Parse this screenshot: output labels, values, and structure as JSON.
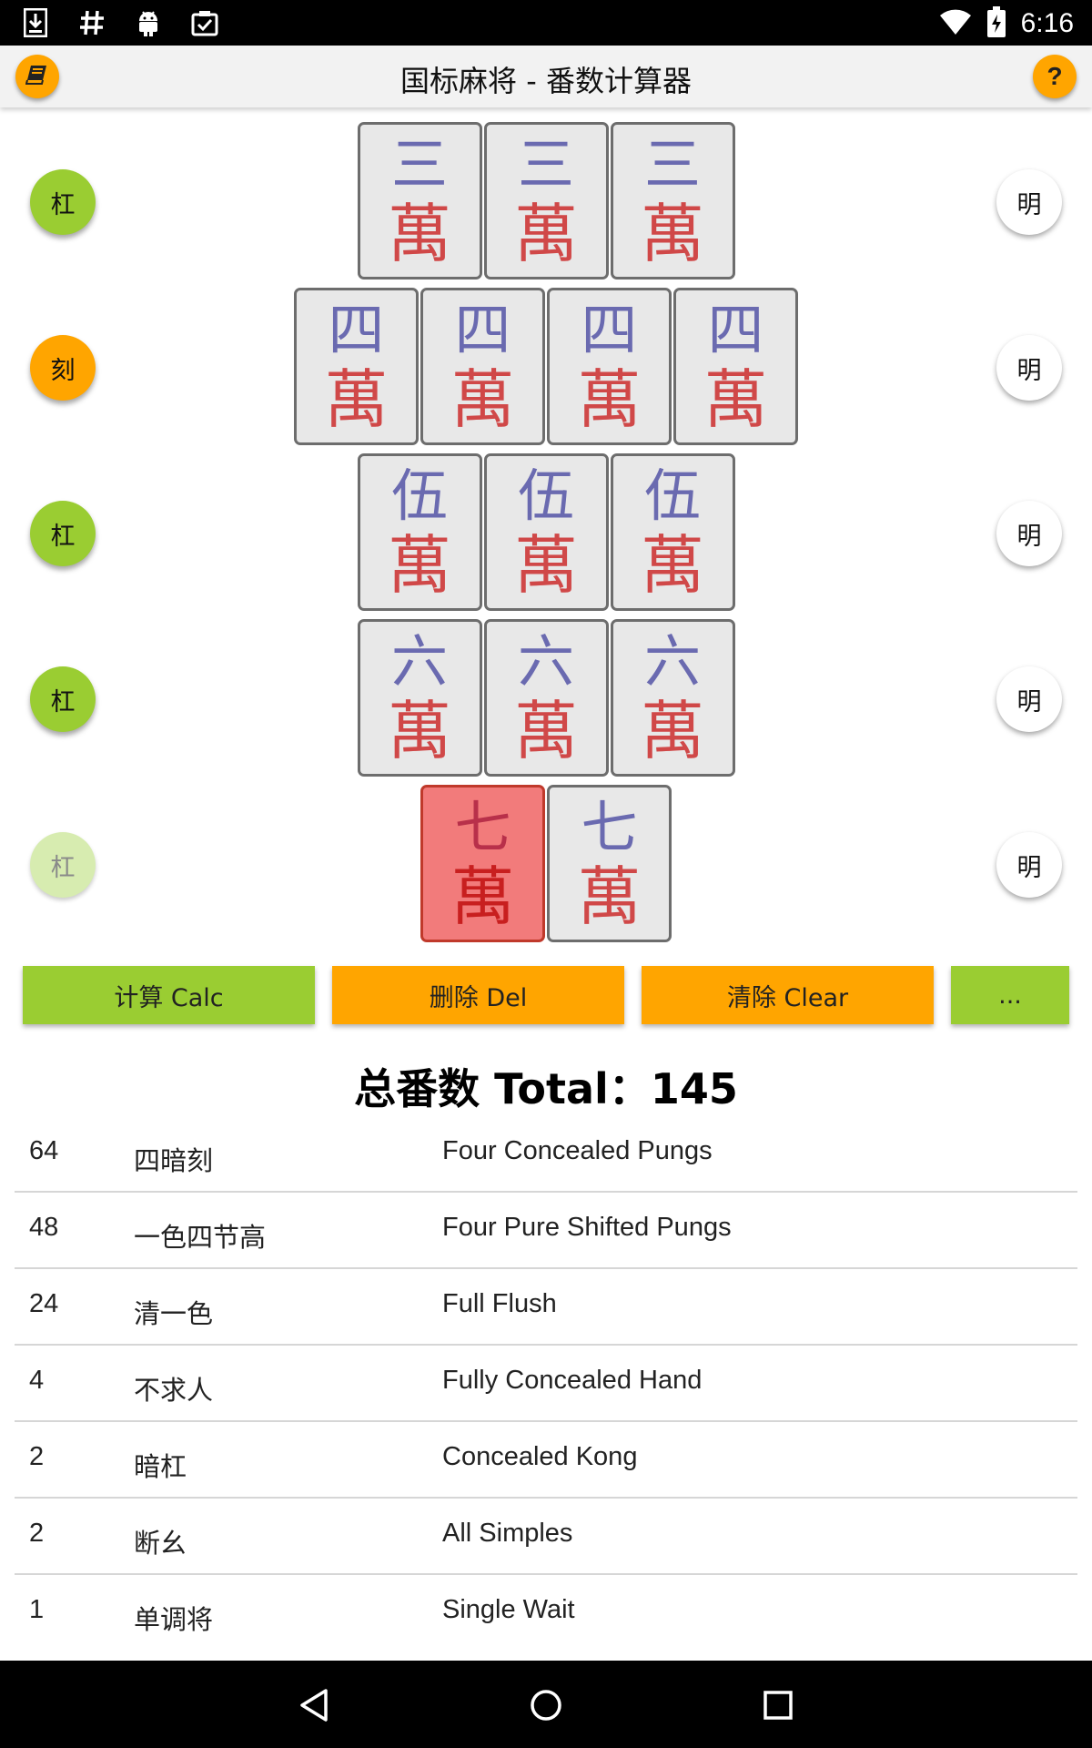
{
  "status_bar": {
    "time": "6:16",
    "left_icons": [
      "download-icon",
      "hash-icon",
      "android-icon",
      "clipboard-check-icon"
    ],
    "right_icons": [
      "wifi-icon",
      "battery-icon"
    ]
  },
  "app_bar": {
    "title": "国标麻将 - 番数计算器",
    "left_icon": "book-icon",
    "help_label": "?"
  },
  "rows": [
    {
      "type_label": "杠",
      "type_state": "green",
      "ming_label": "明",
      "tiles": [
        {
          "num": "三",
          "suit": "萬"
        },
        {
          "num": "三",
          "suit": "萬"
        },
        {
          "num": "三",
          "suit": "萬"
        }
      ]
    },
    {
      "type_label": "刻",
      "type_state": "orange",
      "ming_label": "明",
      "tiles": [
        {
          "num": "四",
          "suit": "萬"
        },
        {
          "num": "四",
          "suit": "萬"
        },
        {
          "num": "四",
          "suit": "萬"
        },
        {
          "num": "四",
          "suit": "萬"
        }
      ]
    },
    {
      "type_label": "杠",
      "type_state": "green",
      "ming_label": "明",
      "tiles": [
        {
          "num": "伍",
          "suit": "萬"
        },
        {
          "num": "伍",
          "suit": "萬"
        },
        {
          "num": "伍",
          "suit": "萬"
        }
      ]
    },
    {
      "type_label": "杠",
      "type_state": "green",
      "ming_label": "明",
      "tiles": [
        {
          "num": "六",
          "suit": "萬"
        },
        {
          "num": "六",
          "suit": "萬"
        },
        {
          "num": "六",
          "suit": "萬"
        }
      ]
    },
    {
      "type_label": "杠",
      "type_state": "faded",
      "ming_label": "明",
      "tiles": [
        {
          "num": "七",
          "suit": "萬",
          "selected": true
        },
        {
          "num": "七",
          "suit": "萬"
        }
      ]
    }
  ],
  "actions": {
    "calc": "计算 Calc",
    "del": "删除 Del",
    "clear": "清除 Clear",
    "more": "..."
  },
  "total": "总番数 Total：145",
  "fans": [
    {
      "points": "64",
      "cn": "四暗刻",
      "en": "Four Concealed Pungs"
    },
    {
      "points": "48",
      "cn": "一色四节高",
      "en": "Four Pure Shifted Pungs"
    },
    {
      "points": "24",
      "cn": "清一色",
      "en": "Full Flush"
    },
    {
      "points": "4",
      "cn": "不求人",
      "en": "Fully Concealed Hand"
    },
    {
      "points": "2",
      "cn": "暗杠",
      "en": "Concealed Kong"
    },
    {
      "points": "2",
      "cn": "断幺",
      "en": "All Simples"
    },
    {
      "points": "1",
      "cn": "单调将",
      "en": "Single Wait"
    }
  ],
  "colors": {
    "green": "#9acd32",
    "orange": "#ffa500",
    "selected_tile": "#f27b7b",
    "tile_bg": "#e8e8e8"
  },
  "nav": [
    "back-icon",
    "home-icon",
    "recents-icon"
  ]
}
